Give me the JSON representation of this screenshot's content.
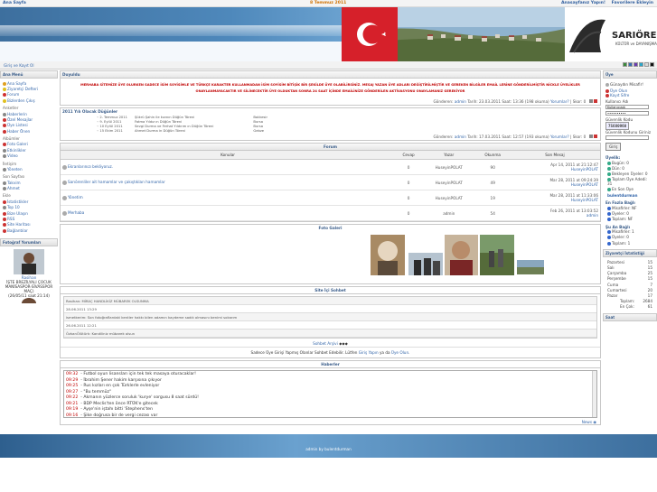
{
  "topbar": {
    "site_link": "Ana Sayfa",
    "date": "8 Temmuz 2011",
    "links": [
      "Anasayfanız Yapın!",
      "Favorilere Ekleyin"
    ]
  },
  "subbar": {
    "link": "Giriş ve Kayıt Ol"
  },
  "left": {
    "menu_title": "Ana Menü",
    "menu_items": [
      "Ana Sayfa",
      "Ziyaretçi Defteri",
      "Forum",
      "Bizlerden Çıkış"
    ],
    "sections": [
      {
        "title": "Anketler",
        "items": [
          "Haberlerin",
          "Özel Mesajlar",
          "Üye Listesi",
          "Haber Önen"
        ]
      },
      {
        "title": "Albümler",
        "items": [
          "Foto Galeri",
          "Etkinlikler",
          "Video"
        ]
      },
      {
        "title": "İletişim",
        "items": [
          "Yöneten"
        ]
      },
      {
        "title": "Son Sayfası",
        "items": [
          "Takvim",
          "Ahmet"
        ]
      },
      {
        "title": "Ekle",
        "items": [
          "İstatistikler",
          "Top 10",
          "Bize Ulaşın",
          "RSS",
          "Site Haritası",
          "Bağlantılar"
        ]
      }
    ],
    "user_title": "Fotoğraf Yorumları",
    "user_name": "Rasihan",
    "user_caption": "İŞTE BREZİLYALI ÇOCUK MANİSASPOR-SİVASSPOR MAÇ)",
    "user_date": "(26/05/11 saat 21:14)"
  },
  "announce": {
    "title": "Duyuldu",
    "text": "MERHABA SİTEMİZE ÜYE OLURKEN SADECE İSİM SOYİSİMLE VE TÜRKÇE KARAKTER KULLANMADAN İSİM SOYİSİM BİTİŞİK BİR ŞEKİLDE ÜYE OLABİLİRSİNİZ. MESAJ YAZAN ÜYE ADLARI DEĞİŞTİRİLMİŞTİR VE GEREKEN BİLGİLER EMAİL LERİNE GÖNDERİLMİŞTİR NİCKLE ÜYELİKLER ONAYLANMAYACAKTIR VE SİLİNECEKTİR ÜYE OLDUKTAN SONRA 24 SAAT İÇİNDE EMAİLİNİZE GÖNDERİLEN AKTİVASYONU ONAYLAMANIZ GEREKİYOR",
    "meta_prefix": "Gönderen: ",
    "meta_author": "admin",
    "meta_rest": " Tarih: 23.03.2011 Saat: 13:36 (198 okuma) ",
    "meta_link": "Yorumlar?",
    "meta_end": " | Skor: 0"
  },
  "birthdays": {
    "title": "2011 Yılı Olacak Düğünler",
    "rows": [
      [
        "2. Temmuz 2011",
        "Şükrü Şahin ile kızının Düğün Töreni",
        "Balıkesir"
      ],
      [
        "9. Eylül 2011",
        "Fatma Yıldız ın Düğün Töreni",
        "Bursa"
      ],
      [
        "10 Eylül 2011",
        "Sevgi Durma ve Ferhat Yıldırım ın Düğün Töreni",
        "Bursa"
      ],
      [
        "15 Ekim 2011",
        "Ahmet Durma in Düğün Töreni",
        "Gebze"
      ]
    ],
    "meta_prefix": "Gönderen: ",
    "meta_author": "admin",
    "meta_rest": " Tarih: 17.03.2011 Saat: 12:57 (193 okuma) ",
    "meta_link": "Yorumlar?",
    "meta_end": " | Skor: 0"
  },
  "forum": {
    "title": "Forum",
    "headers": [
      "Konular",
      "Cevap",
      "Yazar",
      "Okunma",
      "Son Mesaj"
    ],
    "rows": [
      {
        "topic": "Ekranlarınızı bekliyoruz.",
        "replies": "0",
        "author": "HuseyinPOLAT",
        "reads": "90",
        "last_date": "Apr 14, 2011 at 21:12:47",
        "last_user": "HuseyinPOLAT"
      },
      {
        "topic": "Sarıörenliler ait hamamlar ve çakıştıkları hamamlar",
        "replies": "0",
        "author": "HuseyinPOLAT",
        "reads": "49",
        "last_date": "Mar 28, 2011 at 09:24:39",
        "last_user": "HuseyinPOLAT"
      },
      {
        "topic": "Yönetim",
        "replies": "0",
        "author": "HuseyinPOLAT",
        "reads": "19",
        "last_date": "Mar 28, 2011 at 11:33:06",
        "last_user": "HuseyinPOLAT"
      },
      {
        "topic": "Merhaba",
        "replies": "0",
        "author": "admin",
        "reads": "54",
        "last_date": "Feb 26, 2011 at 13:03:52",
        "last_user": "admin"
      }
    ]
  },
  "gallery": {
    "title": "Foto Galeri"
  },
  "shoutbox": {
    "title": "Site İçi Sohbet",
    "messages": [
      "Rasihan: MİRAÇ HANDLİKİZ MÜBAREK OLSUNMA",
      "28.06.2011 13:29",
      "ismetkerim: Son fotoğraflardaki kentler hakkı bilen adamın kaydeme sadık olmasını benimi sokarım",
      "26.06.2011 12:21",
      "ÖzkanÖlütürk: Kandiliniz mübarek olsun"
    ],
    "archive": "Sohbet Arşivi",
    "note_pre": "Sadece Üye Girişi Yapmış Olanlar Sohbet Edebilir. Lütfen ",
    "note_login": "Giriş Yapın",
    "note_mid": " ya da ",
    "note_reg": "Üye Olun",
    "note_end": "."
  },
  "news": {
    "title": "Haberler",
    "items": [
      {
        "time": "09:32",
        "text": "- Futbol oyun lisansları için tek tek masaya oturacaklar!"
      },
      {
        "time": "09:29",
        "text": "- İbrahim Şener hakim karşısına çıkıyor"
      },
      {
        "time": "09:25",
        "text": "- Rus kızları en çok Türklerle evleniyor"
      },
      {
        "time": "09:27",
        "text": "- \"Bu temmüz\""
      },
      {
        "time": "09:22",
        "text": "- Akmanın yüzlerce soruluk 'kurye' sorgusu 8 saat sürdü!"
      },
      {
        "time": "09:21",
        "text": "- BDP Meclis'ten önce RTÜK'e gitecek"
      },
      {
        "time": "09:19",
        "text": "- Ayşe'nin iştahı bitti 'Stephens'ten"
      },
      {
        "time": "09:16",
        "text": "- Şike doğrusa bir de vergi cezası var"
      }
    ],
    "more": "News ◉"
  },
  "right": {
    "login_title": "Üye",
    "welcome": "Günaydın Misafir!",
    "login_links": [
      "Üye Olun",
      "Kayıt Sifre"
    ],
    "user_label": "Kullanıcı Adı",
    "user_value": "Kullanıcıadı",
    "pass_value": "••••••••••",
    "code_label": "Güvenlik Kodu",
    "code_value": "75680960",
    "code_input_label": "Güvenlik Kodunu Giriniz",
    "submit": "Giriş",
    "online_title": "Üyelik:",
    "online_stats": [
      [
        "Bugün",
        "0"
      ],
      [
        "Dün",
        "0"
      ],
      [
        "Bekleyen Üyeler",
        "0"
      ],
      [
        "Toplam Üye Adedi",
        "31"
      ],
      [
        "En Son Üye",
        ""
      ]
    ],
    "newest": "bulentdurman",
    "visitors_title": "En Fazla Bağlı",
    "visitors": [
      [
        "Misafirler",
        "NF"
      ],
      [
        "Üyeler",
        "0"
      ],
      [
        "Toplam",
        "NF"
      ]
    ],
    "now_title": "Şu An Bağlı",
    "now": [
      [
        "Misafirler",
        "1"
      ],
      [
        "Üyeler",
        "0"
      ],
      [
        "Toplam",
        "1"
      ]
    ],
    "stats_title": "Ziyaretçi İstatistiği",
    "stats": [
      [
        "Pazartesi",
        "15"
      ],
      [
        "Salı",
        "15"
      ],
      [
        "Çarşamba",
        "25"
      ],
      [
        "Perşembe",
        "15"
      ],
      [
        "Cuma",
        "7"
      ],
      [
        "Cumartesi",
        "20"
      ],
      [
        "Pazar",
        "17"
      ],
      [
        "Toplam",
        "2684"
      ],
      [
        "En Çok",
        "61"
      ]
    ],
    "time_title": "Saat"
  },
  "footer": {
    "text": "admin by bulentdurman"
  },
  "colors": {
    "accent": "#3a5d8a",
    "alert": "#c00000",
    "header_blue": "#4e88bb",
    "orange": "#d07000"
  }
}
